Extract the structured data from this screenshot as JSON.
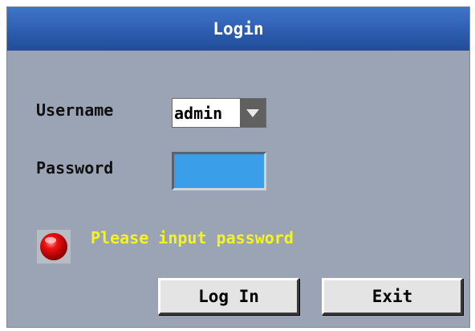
{
  "dialog": {
    "title": "Login"
  },
  "form": {
    "username_label": "Username",
    "username_value": "admin",
    "password_label": "Password",
    "password_value": ""
  },
  "status": {
    "message": "Please input password",
    "indicator_color": "#d40000",
    "icon": "red-light-icon"
  },
  "buttons": {
    "login_label": "Log In",
    "exit_label": "Exit"
  },
  "colors": {
    "title_bar": "#2f5fb2",
    "background": "#9aa4b4",
    "message_text": "#f5f51a",
    "password_field": "#3a9ee8"
  }
}
